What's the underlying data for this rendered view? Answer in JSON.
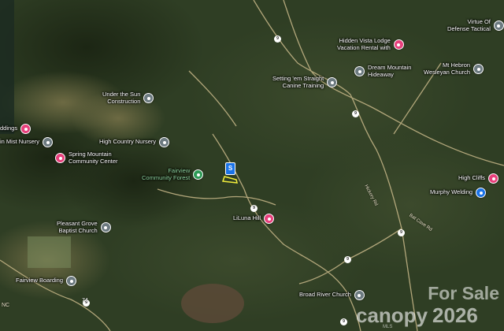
{
  "map": {
    "pois": [
      {
        "id": "virtue-defense",
        "lines": [
          "Virtue Of",
          "Defense Tactical"
        ],
        "pin": "gray",
        "align": "rt"
      },
      {
        "id": "hidden-vista",
        "lines": [
          "Hidden Vista Lodge",
          "Vacation Rental with"
        ],
        "pin": "pink",
        "align": "rt"
      },
      {
        "id": "dream-mountain",
        "lines": [
          "Dream Mountain",
          "Hideaway"
        ],
        "pin": "gray",
        "align": "lt"
      },
      {
        "id": "mt-hebron",
        "lines": [
          "Mt Hebron",
          "Wesleyan Church"
        ],
        "pin": "gray",
        "align": "rt"
      },
      {
        "id": "setting-em-straight",
        "lines": [
          "Setting 'em Straight",
          "Canine Training"
        ],
        "pin": "gray",
        "align": "rt"
      },
      {
        "id": "under-the-sun",
        "lines": [
          "Under the Sun",
          "Construction"
        ],
        "pin": "gray",
        "align": "rt"
      },
      {
        "id": "weddings",
        "lines": [
          "ddings"
        ],
        "pin": "pink",
        "align": "rt"
      },
      {
        "id": "mist-nursery",
        "lines": [
          "in Mist Nursery"
        ],
        "pin": "gray",
        "align": "rt"
      },
      {
        "id": "high-country",
        "lines": [
          "High Country Nursery"
        ],
        "pin": "gray",
        "align": "rt"
      },
      {
        "id": "spring-mountain",
        "lines": [
          "Spring Mountain",
          "Community Center"
        ],
        "pin": "pink",
        "align": "lt"
      },
      {
        "id": "fairview-forest",
        "lines": [
          "Fairview",
          "Community Forest"
        ],
        "pin": "park",
        "align": "rt"
      },
      {
        "id": "high-cliffs",
        "lines": [
          "High Cliffs"
        ],
        "pin": "pink",
        "align": "rt"
      },
      {
        "id": "murphy-welding",
        "lines": [
          "Murphy Welding"
        ],
        "pin": "blue",
        "align": "rt"
      },
      {
        "id": "liluna-hill",
        "lines": [
          "LiLuna Hill"
        ],
        "pin": "pink",
        "align": "rt"
      },
      {
        "id": "pleasant-grove",
        "lines": [
          "Pleasant Grove",
          "Baptist Church"
        ],
        "pin": "gray",
        "align": "rt"
      },
      {
        "id": "fairview-boarding",
        "lines": [
          "Fairview Boarding"
        ],
        "pin": "gray",
        "align": "rt"
      },
      {
        "id": "broad-river",
        "lines": [
          "Broad River Church"
        ],
        "pin": "gray",
        "align": "rt"
      }
    ],
    "shields": [
      "9",
      "9",
      "9",
      "9",
      "9",
      "9",
      "9"
    ],
    "road_labels": [
      "Hickory Rd",
      "Bat Cave Rd"
    ],
    "edge_fragments": [
      "NC",
      "74"
    ],
    "marker": "S",
    "watermark": "For Sale",
    "brand": {
      "name": "canopy",
      "sub": "MLS",
      "year": "2026"
    },
    "colors": {
      "pink": "#e8407c",
      "gray": "#6c7a80",
      "blue": "#1a73e8",
      "park": "#2e9a56",
      "parcel": "#f2ee3c",
      "road": "#c9b98a"
    }
  }
}
